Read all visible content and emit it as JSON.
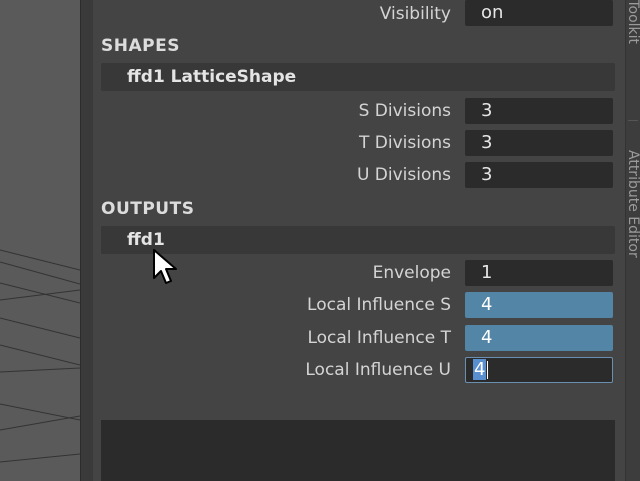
{
  "visibility": {
    "label": "Visibility",
    "value": "on"
  },
  "shapes": {
    "section_label": "SHAPES",
    "node_title": "ffd1 LatticeShape",
    "rows": [
      {
        "label": "S Divisions",
        "value": "3"
      },
      {
        "label": "T Divisions",
        "value": "3"
      },
      {
        "label": "U Divisions",
        "value": "3"
      }
    ]
  },
  "outputs": {
    "section_label": "OUTPUTS",
    "node_title": "ffd1",
    "envelope": {
      "label": "Envelope",
      "value": "1"
    },
    "local_influence_s": {
      "label": "Local Influence S",
      "value": "4"
    },
    "local_influence_t": {
      "label": "Local Influence T",
      "value": "4"
    },
    "local_influence_u": {
      "label": "Local Influence U",
      "value": "4"
    }
  },
  "side_tabs": {
    "top_partial": "g Toolkit",
    "bottom_partial": "Attribute Editor"
  },
  "colors": {
    "panel_bg": "#444444",
    "field_bg": "#2b2b2b",
    "highlight": "#5285a6"
  }
}
